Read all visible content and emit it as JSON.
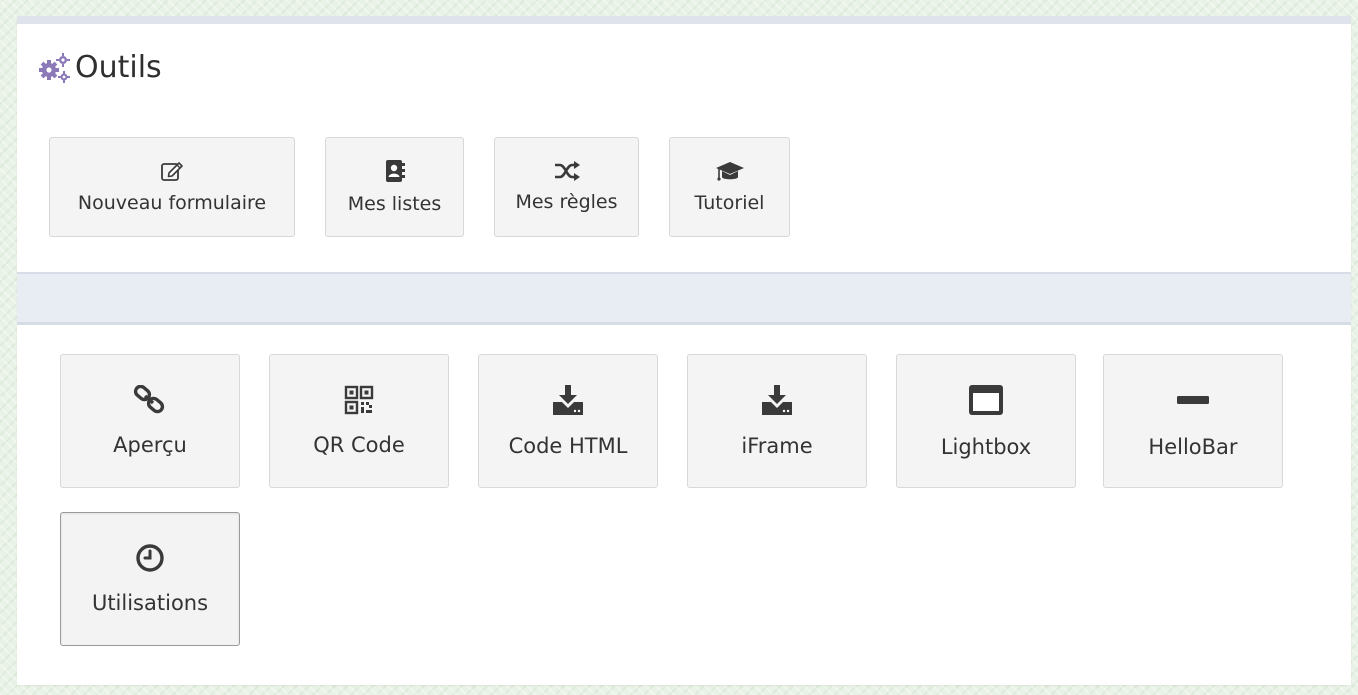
{
  "header": {
    "title": "Outils",
    "title_icon": "cogs-icon",
    "accent_color": "#8b79b8"
  },
  "toolbar": {
    "buttons": [
      {
        "label": "Nouveau formulaire",
        "icon": "edit-icon"
      },
      {
        "label": "Mes listes",
        "icon": "contact-book-icon"
      },
      {
        "label": "Mes règles",
        "icon": "shuffle-icon"
      },
      {
        "label": "Tutoriel",
        "icon": "graduation-cap-icon"
      }
    ]
  },
  "share": {
    "buttons": [
      {
        "label": "Aperçu",
        "icon": "link-icon"
      },
      {
        "label": "QR Code",
        "icon": "qrcode-icon"
      },
      {
        "label": "Code HTML",
        "icon": "download-icon"
      },
      {
        "label": "iFrame",
        "icon": "download-icon"
      },
      {
        "label": "Lightbox",
        "icon": "window-icon"
      },
      {
        "label": "HelloBar",
        "icon": "minus-icon"
      },
      {
        "label": "Utilisations",
        "icon": "clock-icon"
      }
    ]
  }
}
